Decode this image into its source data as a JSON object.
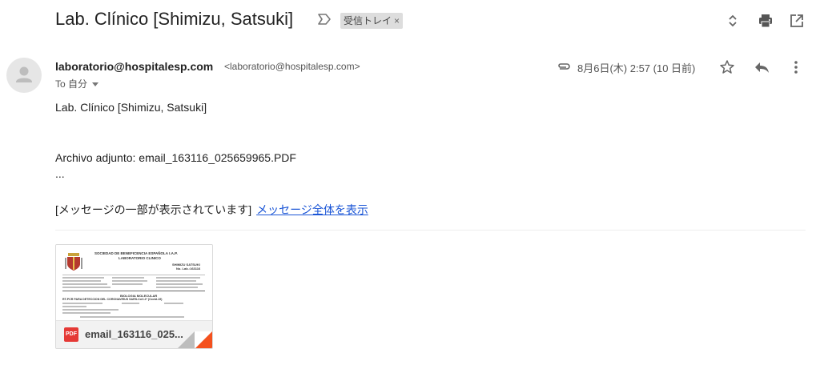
{
  "subject": "Lab. Clínico [Shimizu, Satsuki]",
  "label_chip": {
    "text": "受信トレイ",
    "close": "×"
  },
  "sender": {
    "name": "laboratorio@hospitalesp.com",
    "email": "<laboratorio@hospitalesp.com>",
    "to_line": "To 自分"
  },
  "date": "8月6日(木) 2:57 (10 日前)",
  "body": {
    "line1": "Lab. Clínico [Shimizu, Satsuki]",
    "line2": "Archivo adjunto: email_163116_025659965.PDF",
    "line3": "...",
    "clipped_text": "[メッセージの一部が表示されています]",
    "view_entire_link": "メッセージ全体を表示"
  },
  "attachment": {
    "badge": "PDF",
    "name": "email_163116_025...",
    "thumb_text": {
      "org": "SOCIEDAD DE BENEFICENCIA ESPAÑOLA I.A.P.",
      "lab": "LABORATORIO CLINICO",
      "patient": "SHIMIZU SATSUKI",
      "patient_no": "No. Lab.:163116",
      "section": "BIOLOGIA MOLECULAR",
      "test": "RT-PCR PARA DETECCION DEL CORONAVIRUS SARS-CoV-2* (Covid-19)"
    }
  },
  "icons": {
    "important": "important-marker-icon",
    "expand": "expand-collapse-icon",
    "print": "print-icon",
    "open_new_window": "open-in-new-window-icon",
    "avatar": "person-icon",
    "attachment": "paperclip-icon",
    "star": "star-icon",
    "reply": "reply-icon",
    "more": "more-vert-icon"
  },
  "colors": {
    "link": "#1a55d6",
    "pdf": "#e53935",
    "chip_bg": "#dddddd"
  }
}
